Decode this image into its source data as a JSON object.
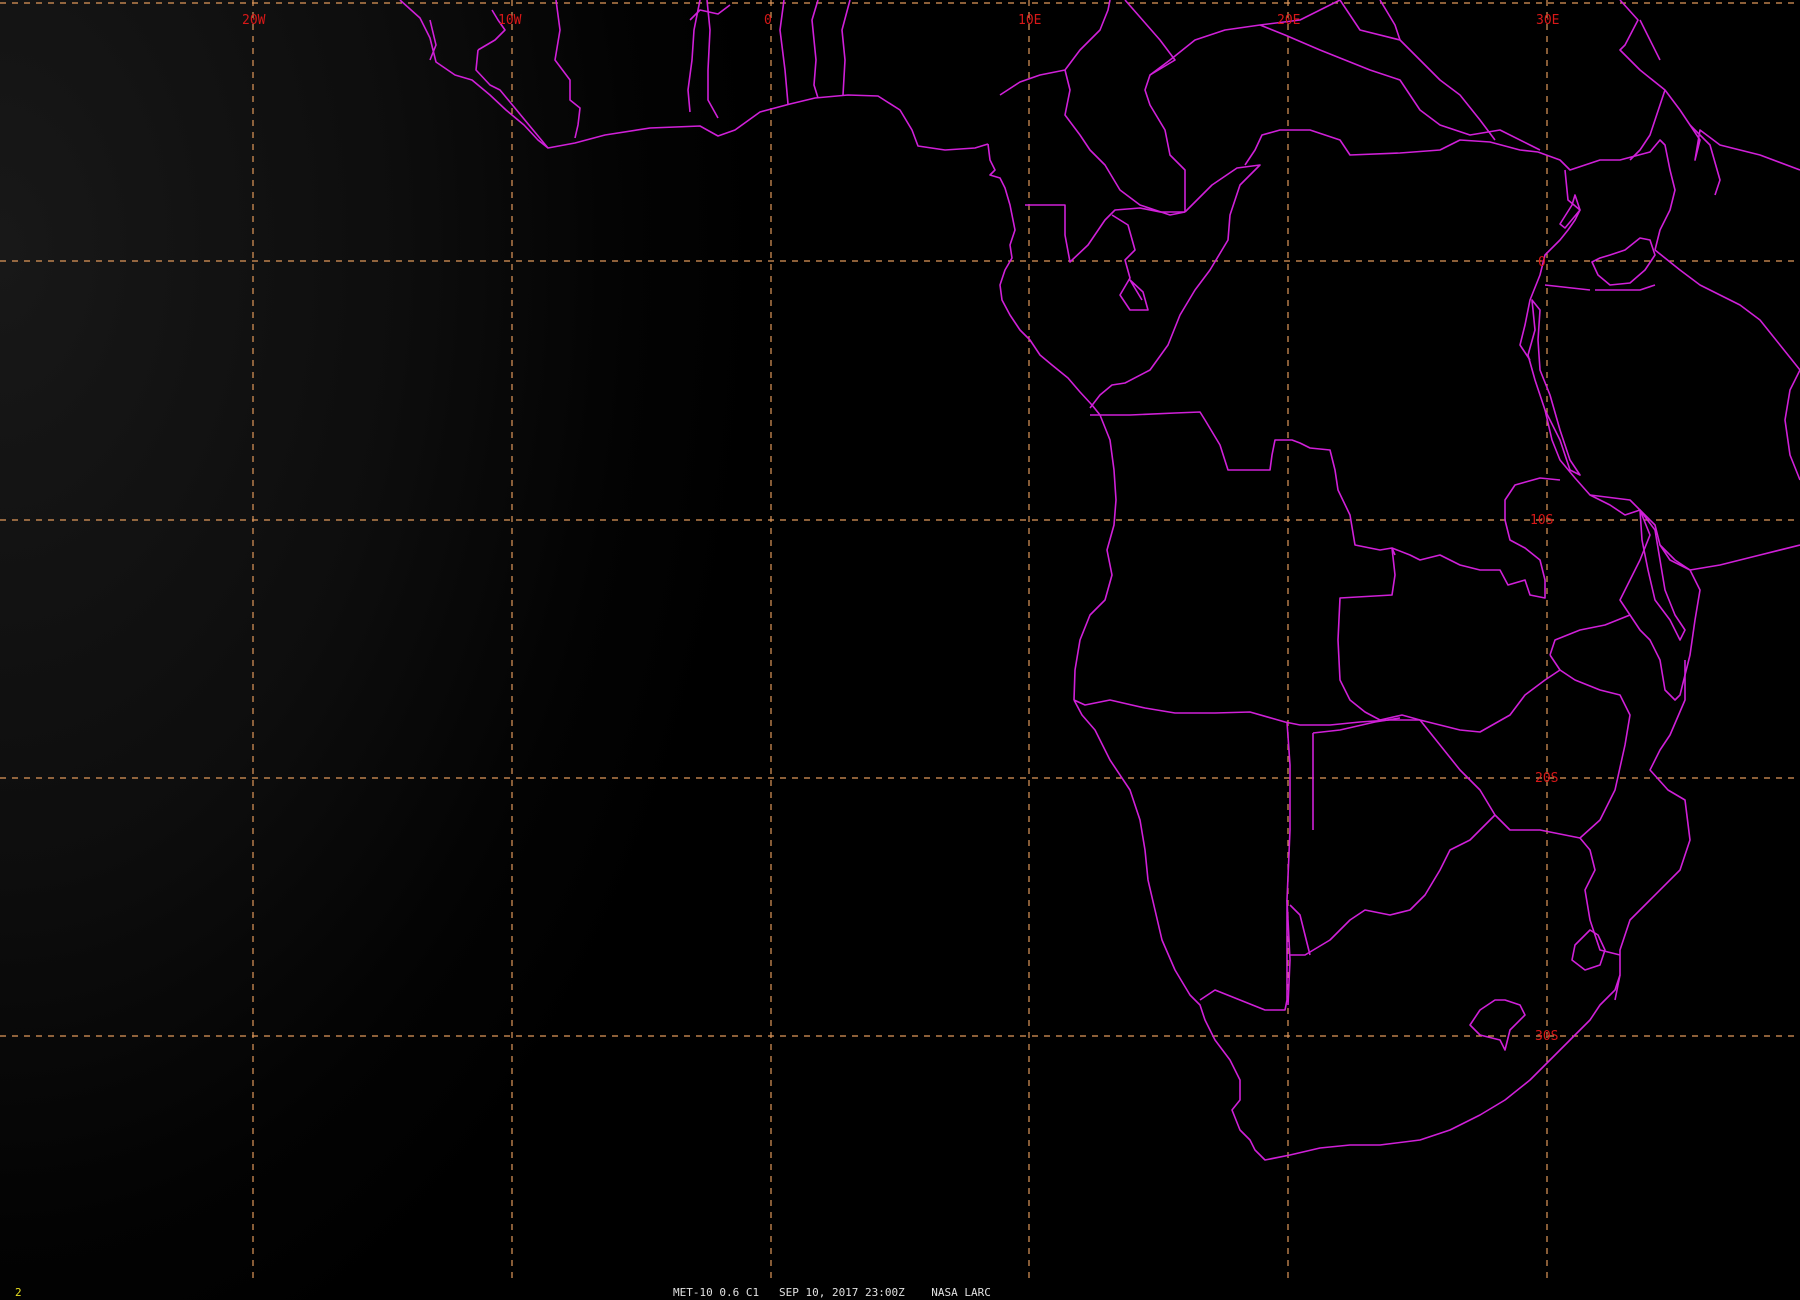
{
  "map": {
    "longitude_labels": [
      "20W",
      "10W",
      "0",
      "10E",
      "20E",
      "30E"
    ],
    "latitude_labels": [
      "0",
      "10S",
      "20S",
      "30S"
    ],
    "graticule_color": "#e0985a",
    "border_color": "#d020d8",
    "label_color": "#d81818"
  },
  "footer": {
    "frame_number": "2",
    "caption": "MET-10 0.6 C1   SEP 10, 2017 23:00Z    NASA LARC"
  }
}
